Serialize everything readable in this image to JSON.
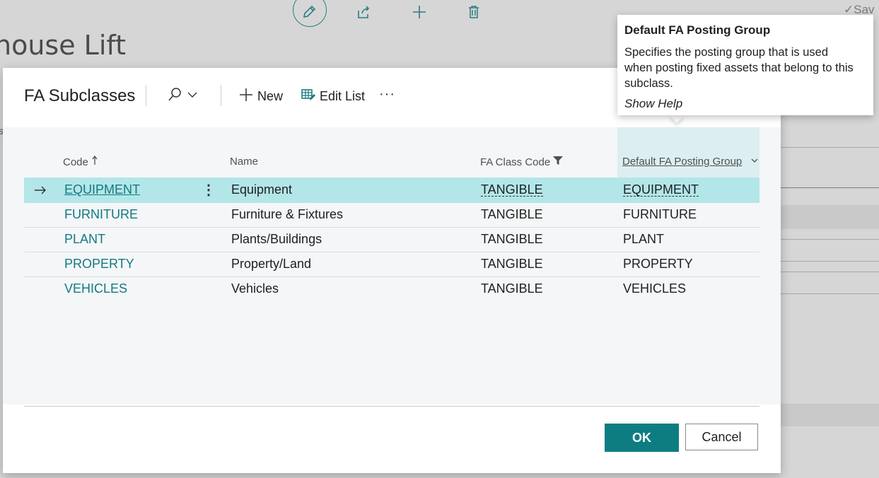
{
  "background": {
    "page_title": "house Lift",
    "saved_label": "Sav",
    "left_fragment": "s",
    "toolbar_icons": [
      "edit-icon",
      "share-icon",
      "plus-icon",
      "trash-icon"
    ]
  },
  "dialog": {
    "title": "FA Subclasses",
    "actions": {
      "search_icon": "search-icon",
      "new_label": "New",
      "edit_list_label": "Edit List",
      "more_label": "···"
    },
    "columns": {
      "code": "Code",
      "name": "Name",
      "fa_class_code": "FA Class Code",
      "default_fa_posting_group": "Default FA Posting Group"
    },
    "rows": [
      {
        "code": "EQUIPMENT",
        "name": "Equipment",
        "fa_class_code": "TANGIBLE",
        "posting_group": "EQUIPMENT"
      },
      {
        "code": "FURNITURE",
        "name": "Furniture & Fixtures",
        "fa_class_code": "TANGIBLE",
        "posting_group": "FURNITURE"
      },
      {
        "code": "PLANT",
        "name": "Plants/Buildings",
        "fa_class_code": "TANGIBLE",
        "posting_group": "PLANT"
      },
      {
        "code": "PROPERTY",
        "name": "Property/Land",
        "fa_class_code": "TANGIBLE",
        "posting_group": "PROPERTY"
      },
      {
        "code": "VEHICLES",
        "name": "Vehicles",
        "fa_class_code": "TANGIBLE",
        "posting_group": "VEHICLES"
      }
    ],
    "ok_label": "OK",
    "cancel_label": "Cancel"
  },
  "tooltip": {
    "title": "Default FA Posting Group",
    "body": "Specifies the posting group that is used when posting fixed assets that belong to this subclass.",
    "show_help": "Show Help"
  },
  "colors": {
    "accent": "#0e7d82",
    "link": "#13797f",
    "selected_row": "#b3e6e9"
  }
}
